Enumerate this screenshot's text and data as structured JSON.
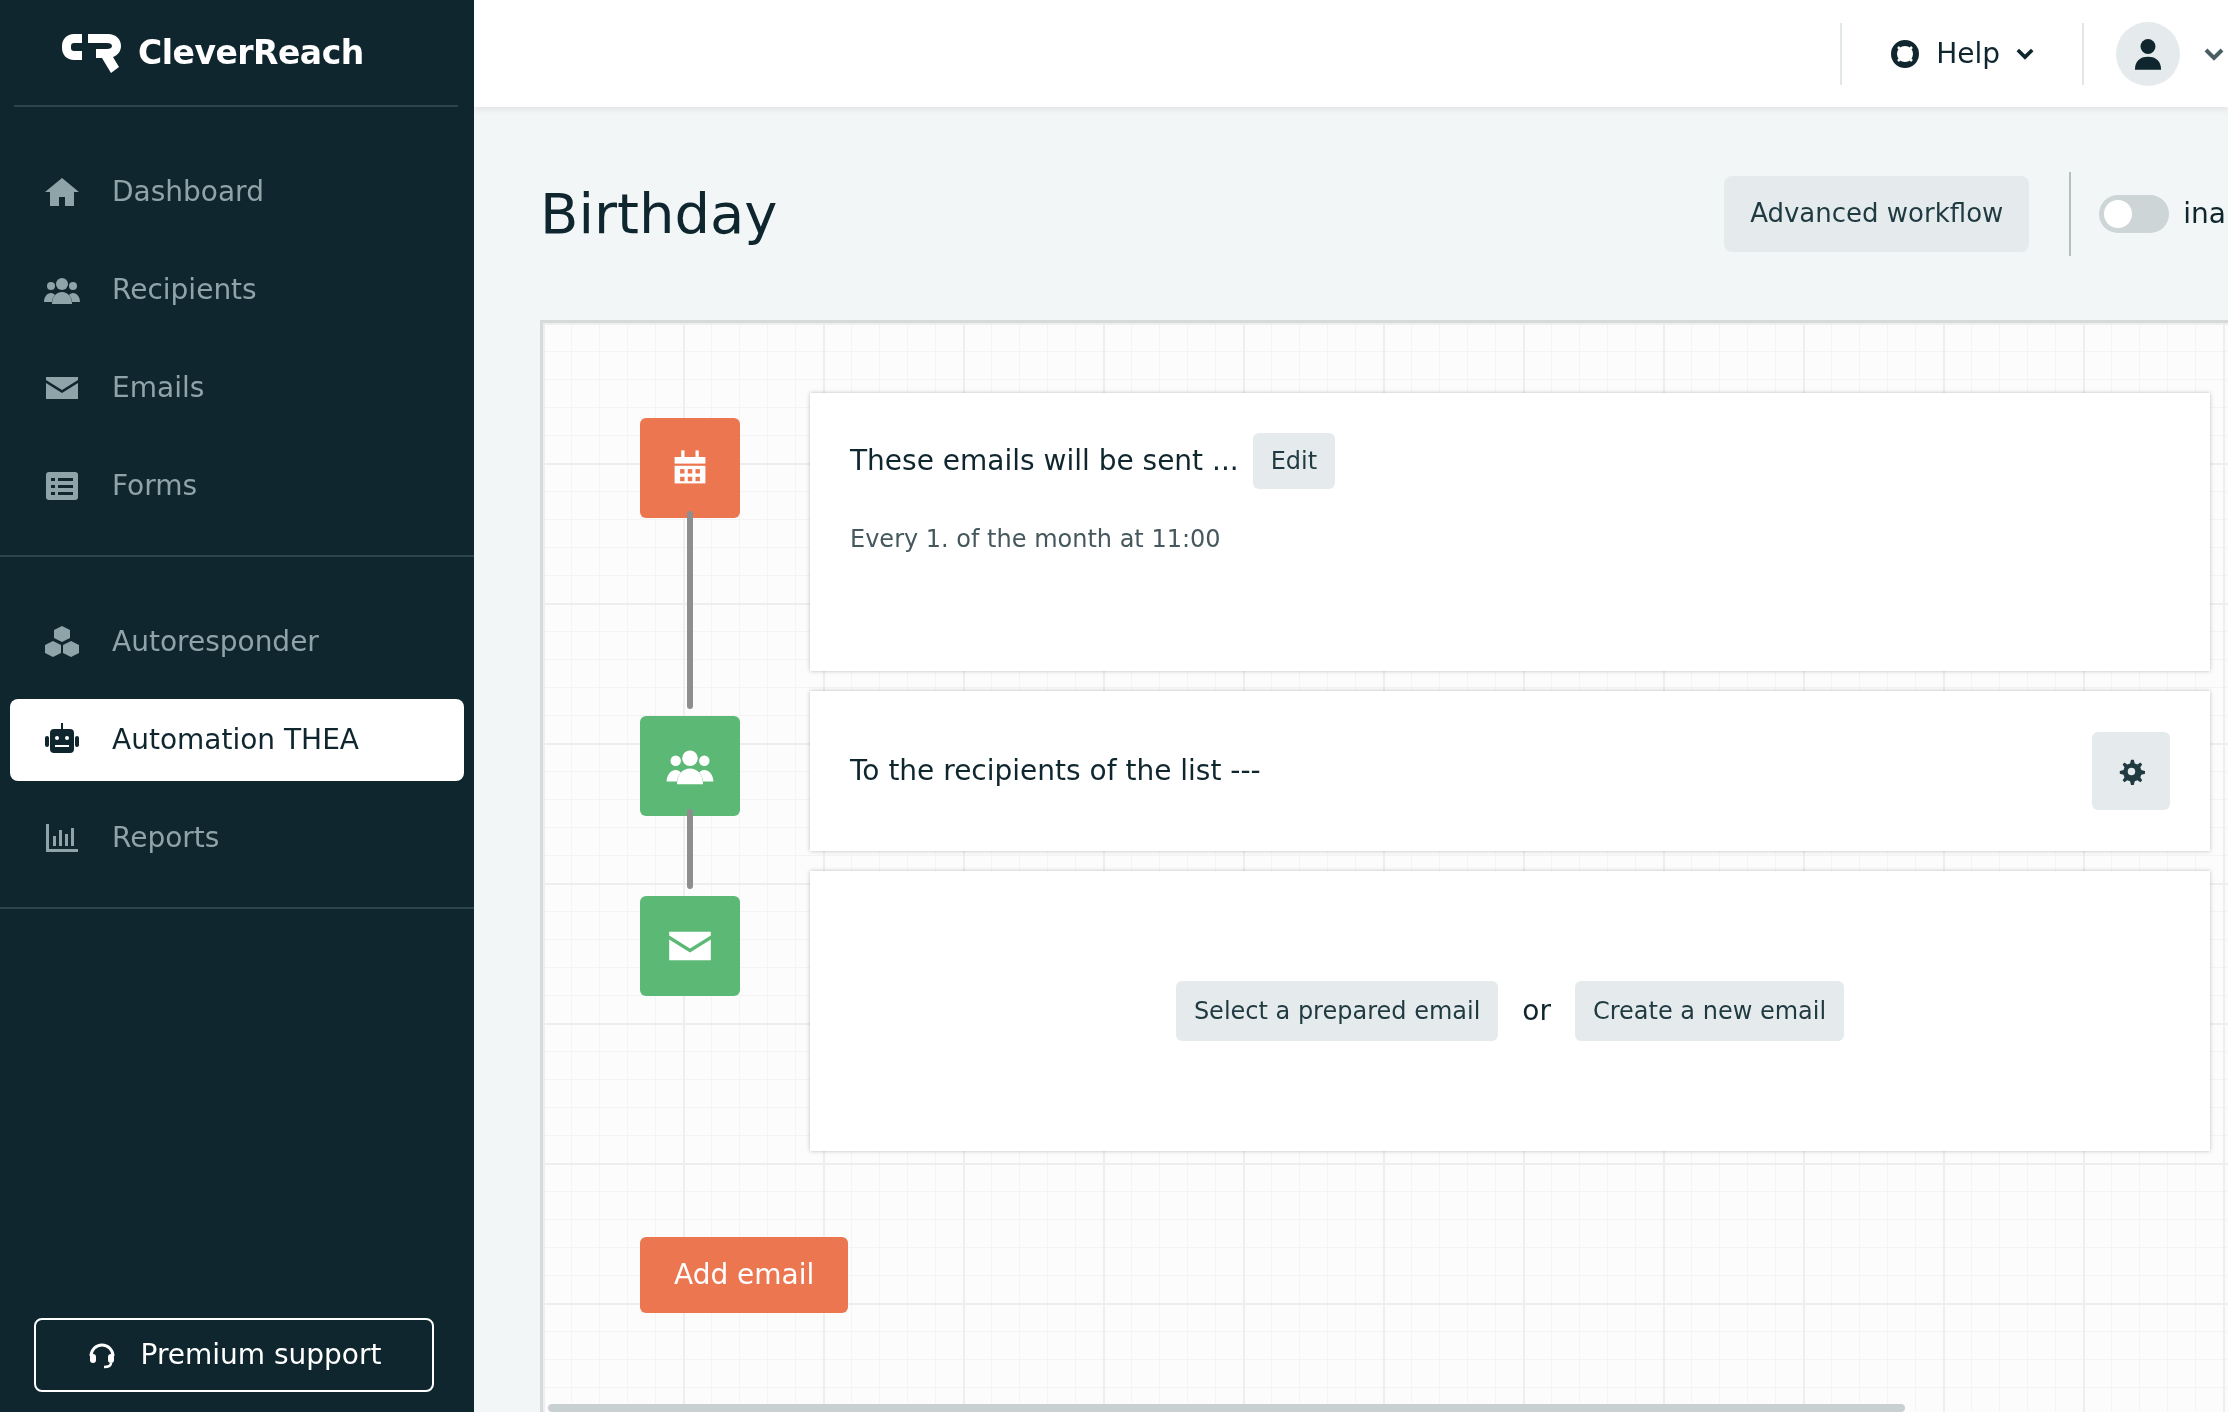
{
  "sidebar": {
    "logo": "CleverReach",
    "groups": [
      [
        {
          "kind": "home",
          "label": "Dashboard",
          "selected": false
        },
        {
          "kind": "users",
          "label": "Recipients",
          "selected": false
        },
        {
          "kind": "mail",
          "label": "Emails",
          "selected": false
        },
        {
          "kind": "list",
          "label": "Forms",
          "selected": false
        }
      ],
      [
        {
          "kind": "cubes",
          "label": "Autoresponder",
          "selected": false
        },
        {
          "kind": "robot",
          "label": "Automation THEA",
          "selected": true
        },
        {
          "kind": "chart",
          "label": "Reports",
          "selected": false
        }
      ]
    ],
    "support_button": "Premium support"
  },
  "header": {
    "help": "Help"
  },
  "page": {
    "title": "Birthday",
    "advanced_button": "Advanced workflow",
    "toggle": {
      "on": false,
      "label": "ina"
    }
  },
  "workflow": {
    "steps": [
      {
        "kind": "schedule",
        "color": "#ec7650",
        "title": "These emails will be sent ...",
        "edit_button": "Edit",
        "detail": "Every 1. of the month at 11:00"
      },
      {
        "kind": "recipients",
        "color": "#5cb975",
        "title": "To the recipients of the list ---"
      },
      {
        "kind": "email",
        "color": "#5cb975",
        "select_button": "Select a prepared email",
        "separator": "or",
        "create_button": "Create a new email"
      }
    ],
    "add_button": "Add email"
  }
}
